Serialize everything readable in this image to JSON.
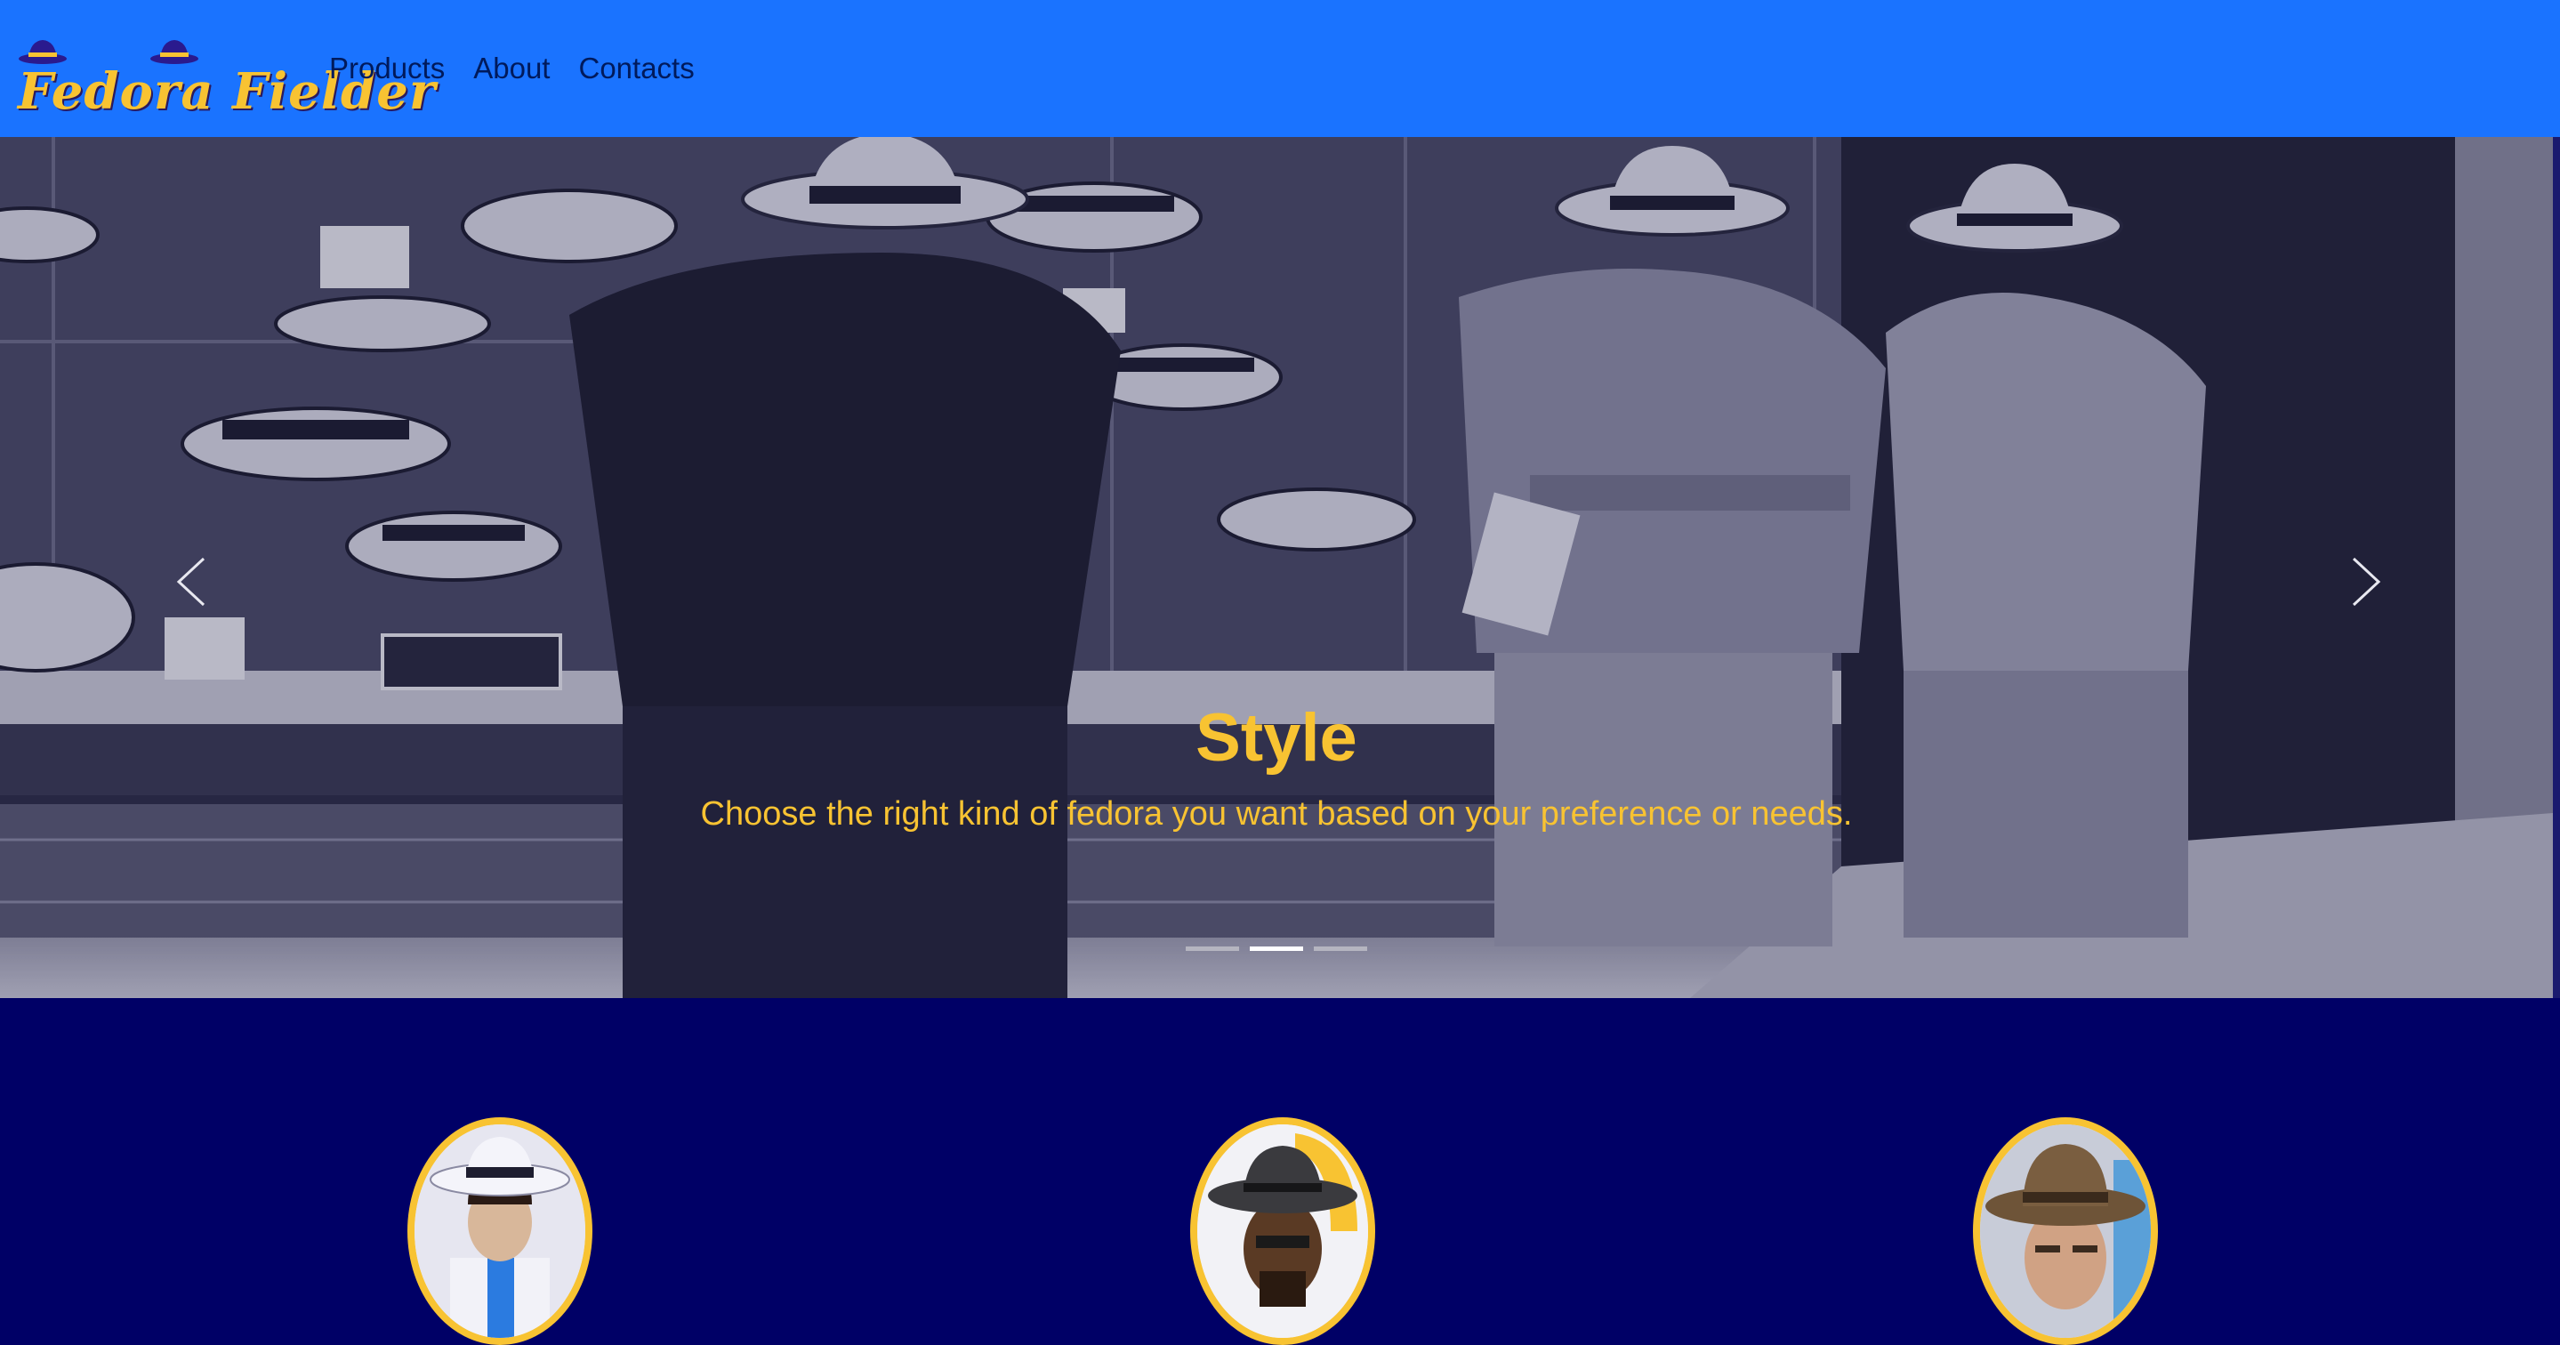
{
  "navbar": {
    "brand": "Fedora Fielder",
    "links": [
      "Products",
      "About",
      "Contacts"
    ],
    "bg_color": "#1a73ff",
    "brand_color": "#f8c332"
  },
  "carousel": {
    "slides_count": 3,
    "active_index": 1,
    "caption_title": "Style",
    "caption_text": "Choose the right kind of fedora you want based on your preference or needs.",
    "caption_color": "#f8c332",
    "prev_icon": "chevron-left-icon",
    "next_icon": "chevron-right-icon"
  },
  "featured": {
    "avatars": [
      "avatar-1",
      "avatar-2",
      "avatar-3"
    ],
    "border_color": "#f8c332"
  },
  "page": {
    "bg_color": "#000066"
  }
}
